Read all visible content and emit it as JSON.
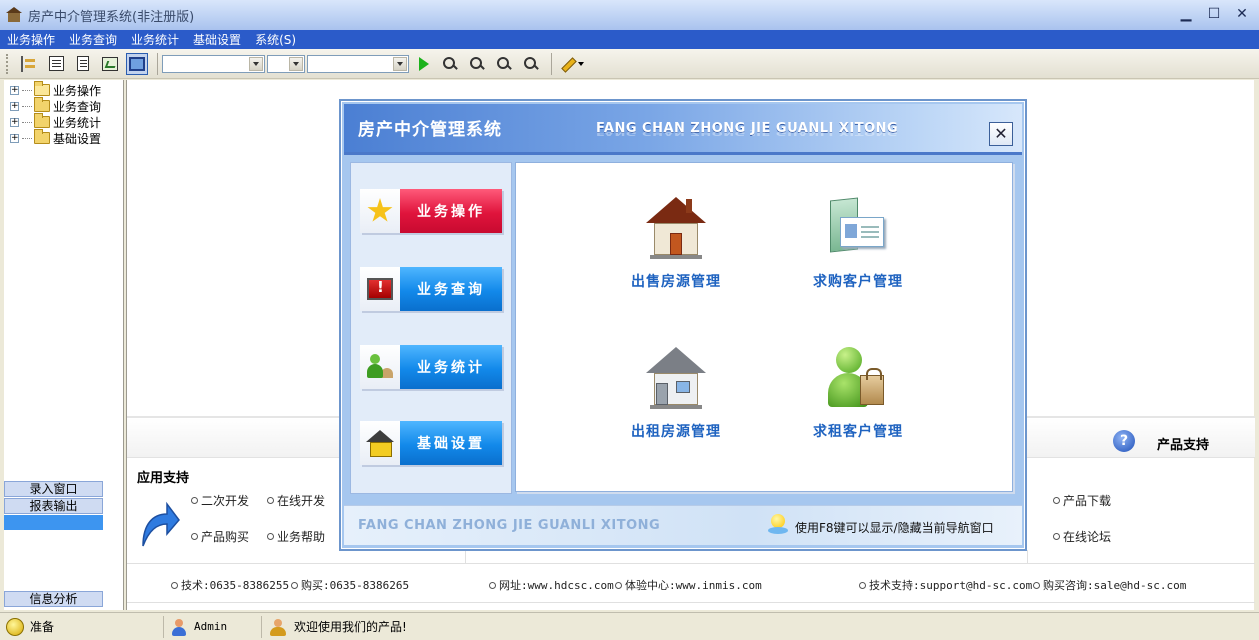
{
  "window": {
    "title": "房产中介管理系统(非注册版)",
    "minimize": "▁",
    "maximize": "☐",
    "close": "✕"
  },
  "menu": [
    "业务操作",
    "业务查询",
    "业务统计",
    "基础设置",
    "系统(S)"
  ],
  "tree": [
    {
      "label": "业务操作",
      "expand": "+"
    },
    {
      "label": "业务查询",
      "expand": "+"
    },
    {
      "label": "业务统计",
      "expand": "+"
    },
    {
      "label": "基础设置",
      "expand": "+"
    }
  ],
  "side_tabs": {
    "entry": "录入窗口",
    "report": "报表输出",
    "analysis": "信息分析"
  },
  "main": {
    "product_support": "产品支持",
    "help_glyph": "?",
    "app_support": "应用支持",
    "links_left": [
      "二次开发",
      "在线开发",
      "产品购买",
      "业务帮助"
    ],
    "links_right": [
      "产品下载",
      "在线论坛"
    ],
    "contacts": {
      "tech_phone": "技术:0635-8386255",
      "buy_phone": "购买:0635-8386265",
      "website": "网址:www.hdcsc.com",
      "experience": "体验中心:www.inmis.com",
      "support_mail": "技术支持:support@hd-sc.com",
      "sale_mail": "购买咨询:sale@hd-sc.com"
    }
  },
  "dialog": {
    "title": "房产中介管理系统",
    "subtitle": "FANG CHAN ZHONG JIE GUANLI XITONG",
    "close": "✕",
    "nav": [
      {
        "label": "业务操作",
        "icon": "star-icon",
        "color": "red"
      },
      {
        "label": "业务查询",
        "icon": "alert-monitor-icon",
        "color": "blue"
      },
      {
        "label": "业务统计",
        "icon": "person-icon",
        "color": "blue"
      },
      {
        "label": "基础设置",
        "icon": "house-icon",
        "color": "blue"
      }
    ],
    "tiles": [
      {
        "label": "出售房源管理",
        "icon": "house-red-roof-icon"
      },
      {
        "label": "求购客户管理",
        "icon": "business-card-icon"
      },
      {
        "label": "出租房源管理",
        "icon": "house-gray-icon"
      },
      {
        "label": "求租客户管理",
        "icon": "client-shopping-icon"
      }
    ],
    "footer_brand": "FANG CHAN ZHONG JIE GUANLI XITONG",
    "hint": "使用F8键可以显示/隐藏当前导航窗口"
  },
  "status": {
    "ready": "准备",
    "user": "Admin",
    "welcome": "欢迎使用我们的产品!"
  },
  "colors": {
    "menubar": "#2b5bc9",
    "nav_red": "#e0143c",
    "nav_blue": "#1289ea",
    "tile_text": "#1f63c0"
  }
}
